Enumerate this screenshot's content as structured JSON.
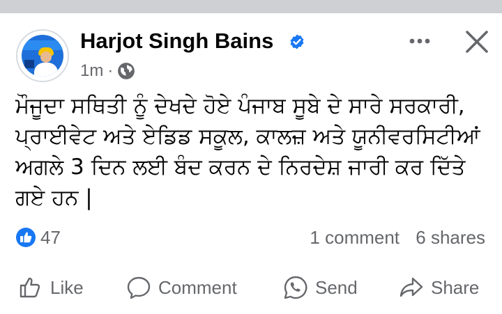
{
  "post": {
    "author": "Harjot Singh Bains",
    "time": "1m",
    "separator": "·",
    "body": "ਮੌਜੂਦਾ ਸਥਿਤੀ ਨੂੰ ਦੇਖਦੇ ਹੋਏ ਪੰਜਾਬ ਸੂਬੇ ਦੇ ਸਾਰੇ ਸਰਕਾਰੀ,\nਪ੍ਰਾਈਵੇਟ ਅਤੇ ਏਡਿਡ ਸਕੂਲ, ਕਾਲਜ਼ ਅਤੇ ਯੂਨੀਵਰਸਿਟੀਆਂ\nਅਗਲੇ 3 ਦਿਨ ਲਈ ਬੰਦ ਕਰਨ ਦੇ ਨਿਰਦੇਸ਼ ਜਾਰੀ ਕਰ ਦਿੱਤੇ\nਗਏ ਹਨ |",
    "reaction_count": "47",
    "comments": "1 comment",
    "shares": "6 shares"
  },
  "actions": {
    "like": "Like",
    "comment": "Comment",
    "send": "Send",
    "share": "Share"
  },
  "icons": {
    "verified": "verified-badge-icon",
    "globe": "globe-icon",
    "more": "more-dots-icon",
    "close": "close-icon",
    "like_reaction": "like-reaction-icon"
  },
  "colors": {
    "accent": "#1877f2",
    "muted": "#65676b",
    "text": "#050505",
    "divider": "#ced0d4"
  }
}
